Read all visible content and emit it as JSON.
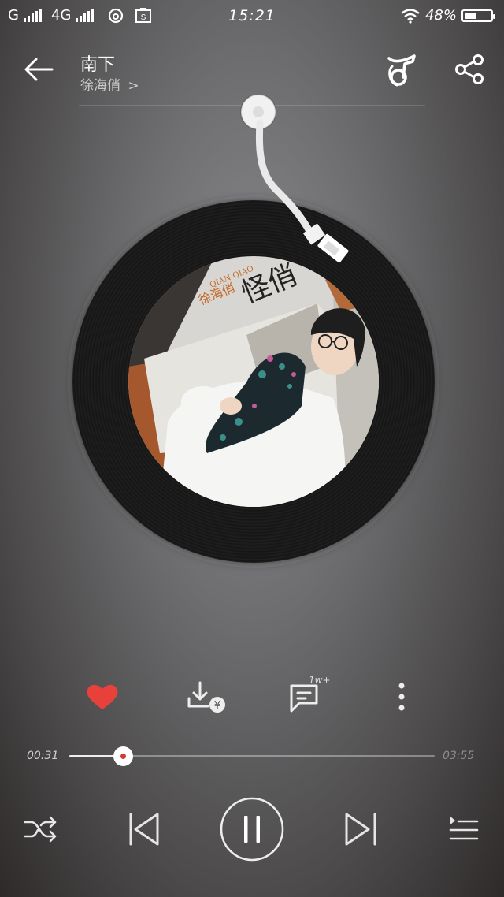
{
  "status_bar": {
    "carrier_1": "G",
    "carrier_2": "4G",
    "time": "15:21",
    "battery_text": "48%",
    "battery_level": 0.48
  },
  "header": {
    "song_title": "南下",
    "artist": "徐海俏",
    "artist_chevron": ">"
  },
  "album": {
    "art_text_1": "怪俏",
    "art_text_2": "QIAN QIAO",
    "art_text_3": "徐海俏"
  },
  "actions": {
    "like_color": "#e8403a",
    "liked": true,
    "comment_count": "1w+"
  },
  "player": {
    "current_time": "00:31",
    "total_time": "03:55",
    "progress": 0.146,
    "state": "playing"
  },
  "icons": {
    "back": "arrow-left-icon",
    "ktv": "ktv-note-icon",
    "share": "share-icon",
    "like": "heart-icon",
    "download": "download-paid-icon",
    "comment": "comment-icon",
    "more": "more-vertical-icon",
    "shuffle": "shuffle-icon",
    "previous": "previous-icon",
    "pause": "pause-icon",
    "next": "next-icon",
    "playlist": "playlist-icon"
  }
}
